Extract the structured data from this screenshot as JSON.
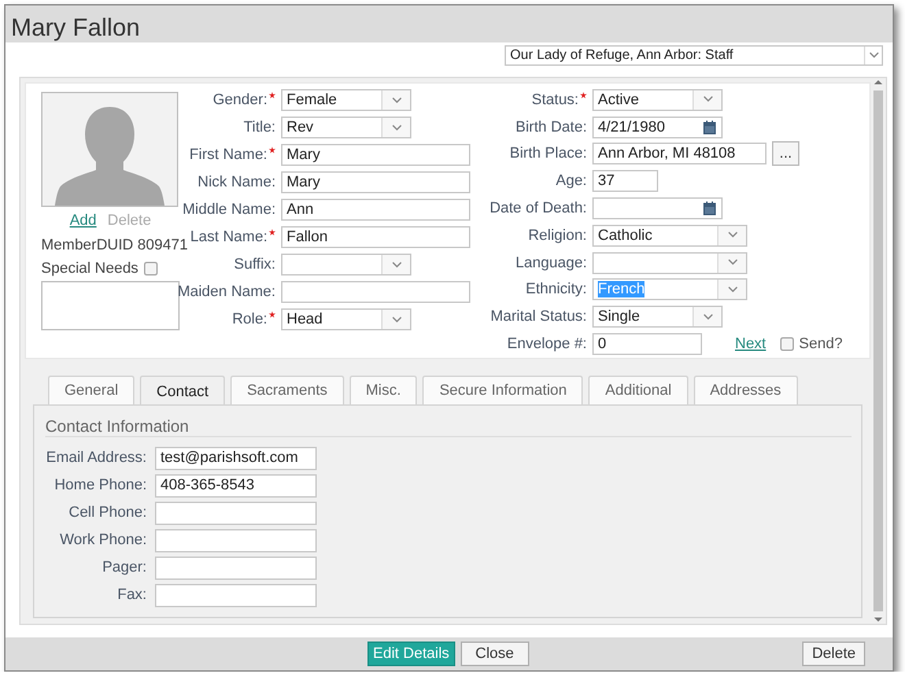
{
  "window": {
    "title": "Mary Fallon"
  },
  "context_select": {
    "value": "Our Lady of Refuge, Ann Arbor: Staff"
  },
  "photo": {
    "links": [
      {
        "label": "Add",
        "disabled": false
      },
      {
        "label": "Delete",
        "disabled": true
      }
    ],
    "member_duid": "MemberDUID 809471",
    "special_needs": {
      "label": "Special Needs",
      "checked": false
    }
  },
  "left_fields": [
    {
      "label": "Gender:",
      "required": true,
      "kind": "select",
      "value": "Female",
      "highlighted": false
    },
    {
      "label": "Title:",
      "required": false,
      "kind": "select",
      "value": "Rev",
      "highlighted": false
    },
    {
      "label": "First Name:",
      "required": true,
      "kind": "text",
      "value": "Mary",
      "highlighted": false
    },
    {
      "label": "Nick Name:",
      "required": false,
      "kind": "text",
      "value": "Mary",
      "highlighted": false
    },
    {
      "label": "Middle Name:",
      "required": false,
      "kind": "text",
      "value": "Ann",
      "highlighted": false
    },
    {
      "label": "Last Name:",
      "required": true,
      "kind": "text",
      "value": "Fallon",
      "highlighted": false
    },
    {
      "label": "Suffix:",
      "required": false,
      "kind": "select",
      "highlighted": false
    },
    {
      "label": "Maiden Name:",
      "required": false,
      "kind": "text",
      "highlighted": false
    },
    {
      "label": "Role:",
      "required": true,
      "kind": "select",
      "value": "Head",
      "highlighted": false
    }
  ],
  "right_fields": [
    {
      "label": "Status:",
      "required": true,
      "kind": "select",
      "value": "Active",
      "highlighted": false
    },
    {
      "label": "Birth Date:",
      "required": false,
      "kind": "date",
      "value": "4/21/1980",
      "highlighted": false
    },
    {
      "label": "Birth Place:",
      "required": false,
      "kind": "lookup",
      "value": "Ann Arbor, MI 48108",
      "button": "...",
      "highlighted": false
    },
    {
      "label": "Age:",
      "required": false,
      "kind": "short-text",
      "value": "37",
      "highlighted": false
    },
    {
      "label": "Date of Death:",
      "required": false,
      "kind": "date",
      "highlighted": false
    },
    {
      "label": "Religion:",
      "required": false,
      "kind": "wide-select",
      "value": "Catholic",
      "highlighted": false
    },
    {
      "label": "Language:",
      "required": false,
      "kind": "wide-select",
      "highlighted": false
    },
    {
      "label": "Ethnicity:",
      "required": false,
      "kind": "wide-select",
      "value": "French",
      "highlighted": true
    },
    {
      "label": "Marital Status:",
      "required": false,
      "kind": "select",
      "value": "Single",
      "highlighted": false
    },
    {
      "label": "Envelope #:",
      "required": false,
      "kind": "envelope",
      "value": "0",
      "link": "Next",
      "checkbox": {
        "label": "Send?",
        "checked": false
      },
      "highlighted": false
    }
  ],
  "tabs": [
    {
      "label": "General",
      "selected": false
    },
    {
      "label": "Contact",
      "selected": true
    },
    {
      "label": "Sacraments",
      "selected": false
    },
    {
      "label": "Misc.",
      "selected": false
    },
    {
      "label": "Secure Information",
      "selected": false
    },
    {
      "label": "Additional",
      "selected": false
    },
    {
      "label": "Addresses",
      "selected": false
    }
  ],
  "contact": {
    "heading": "Contact Information",
    "fields": [
      {
        "label": "Email Address:",
        "value": "test@parishsoft.com"
      },
      {
        "label": "Home Phone:",
        "value": "408-365-8543"
      },
      {
        "label": "Cell Phone:"
      },
      {
        "label": "Work Phone:"
      },
      {
        "label": "Pager:"
      },
      {
        "label": "Fax:"
      }
    ]
  },
  "buttons": [
    {
      "label": "Edit Details",
      "kind": "primary"
    },
    {
      "label": "Close",
      "kind": "default"
    },
    {
      "label": "Delete",
      "kind": "right"
    }
  ]
}
